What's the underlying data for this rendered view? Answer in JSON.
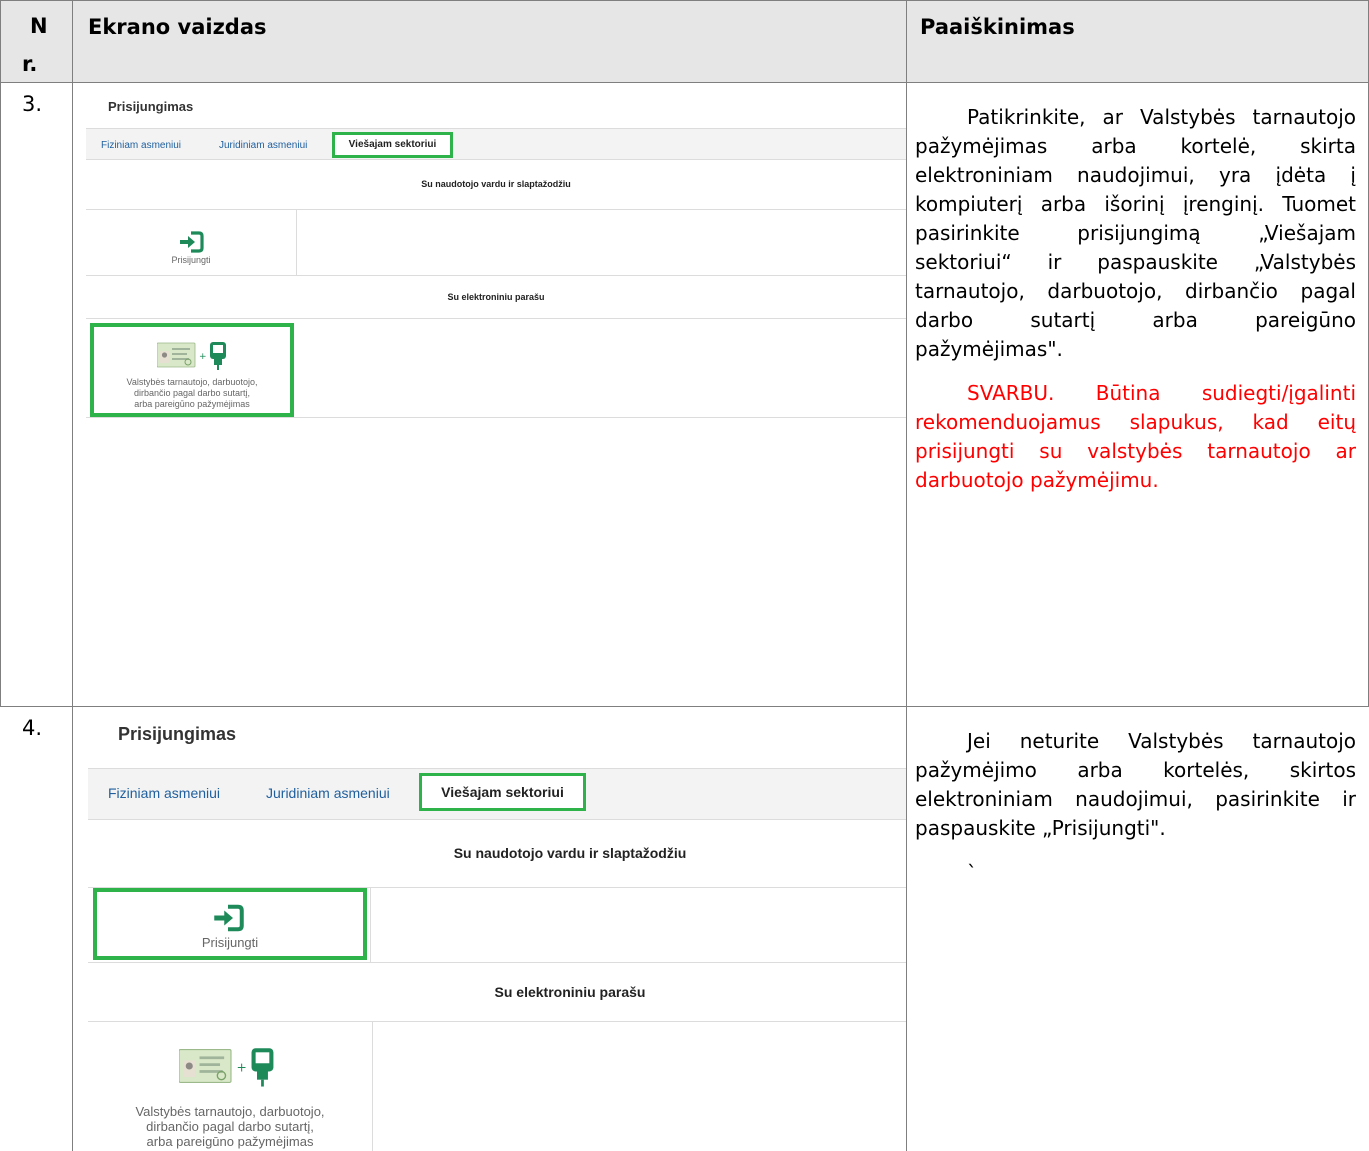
{
  "header": {
    "col_nr": "N r.",
    "col_nr_line1": "N",
    "col_nr_line2": "r.",
    "col_screen": "Ekrano vaizdas",
    "col_expl": "Paaiškinimas"
  },
  "rows": [
    {
      "nr": "3.",
      "screen": {
        "title": "Prisijungimas",
        "tabs": [
          "Fiziniam asmeniui",
          "Juridiniam asmeniui",
          "Viešajam sektoriui"
        ],
        "active_tab": "Viešajam sektoriui",
        "section_password": "Su naudotojo vardu ir slaptažodžiu",
        "login_label": "Prisijungti",
        "section_esign": "Su elektroniniu parašu",
        "card_label": "Valstybės tarnautojo, darbuotojo, dirbančio pagal darbo sutartį, arba pareigūno pažymėjimas",
        "card_label_lines": [
          "Valstybės tarnautojo, darbuotojo,",
          "dirbančio pagal darbo sutartį,",
          "arba pareigūno pažymėjimas"
        ],
        "highlighted": "card"
      },
      "explanation": "Patikrinkite, ar Valstybės tarnautojo pažymėjimas arba kortelė, skirta elektroniniam naudojimui, yra įdėta į kompiuterį arba išorinį įrenginį. Tuomet pasirinkite prisijungimą „Viešajam sektoriui“ ir paspauskite „Valstybės tarnautojo, darbuotojo, dirbančio pagal darbo sutartį arba pareigūno pažymėjimas\".",
      "warning": "SVARBU. Būtina sudiegti/įgalinti rekomenduojamus slapukus, kad eitų prisijungti su valstybės tarnautojo ar darbuotojo pažymėjimu."
    },
    {
      "nr": "4.",
      "screen": {
        "title": "Prisijungimas",
        "tabs": [
          "Fiziniam asmeniui",
          "Juridiniam asmeniui",
          "Viešajam sektoriui"
        ],
        "active_tab": "Viešajam sektoriui",
        "section_password": "Su naudotojo vardu ir slaptažodžiu",
        "login_label": "Prisijungti",
        "section_esign": "Su elektroniniu parašu",
        "card_label": "Valstybės tarnautojo, darbuotojo, dirbančio pagal darbo sutartį, arba pareigūno pažymėjimas",
        "card_label_lines": [
          "Valstybės tarnautojo, darbuotojo,",
          "dirbančio pagal darbo sutartį,",
          "arba pareigūno pažymėjimas"
        ],
        "highlighted": "login"
      },
      "explanation": "Jei neturite Valstybės tarnautojo pažymėjimo arba kortelės, skirtos elektroniniam naudojimui, pasirinkite ir paspauskite „Prisijungti\".",
      "trailing_mark": "`"
    }
  ],
  "colors": {
    "header_bg": "#e7e6e6",
    "highlight_green": "#2db34a",
    "icon_green": "#1e8a5a",
    "tab_link": "#1f5f9e",
    "warning_red": "#ff0000"
  },
  "icons": [
    "login-arrow-icon",
    "id-card-icon",
    "card-reader-icon"
  ]
}
